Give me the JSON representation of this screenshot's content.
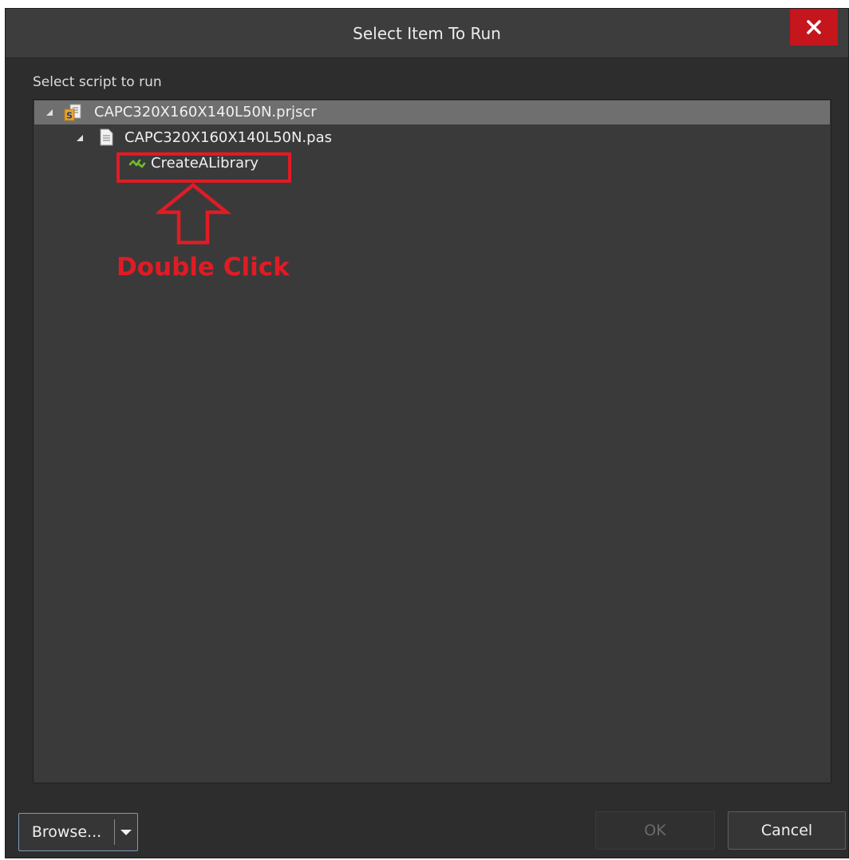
{
  "window": {
    "title": "Select Item To Run"
  },
  "section_label": "Select script to run",
  "tree": {
    "items": [
      {
        "label": "CAPC320X160X140L50N.prjscr",
        "icon": "script-project-icon",
        "expanded": true,
        "selected": true
      },
      {
        "label": "CAPC320X160X140L50N.pas",
        "icon": "document-icon",
        "expanded": true,
        "selected": false
      },
      {
        "label": "CreateALibrary",
        "icon": "procedure-icon",
        "selected": false
      }
    ]
  },
  "annotation": {
    "text": "Double Click",
    "color": "#e11b24"
  },
  "buttons": {
    "browse": "Browse...",
    "ok": "OK",
    "cancel": "Cancel"
  },
  "colors": {
    "background": "#2d2d2d",
    "titlebar": "#3d3d3d",
    "close": "#c4161c",
    "tree_background": "#3a3a3a",
    "selected_row": "#6f6f6f"
  }
}
